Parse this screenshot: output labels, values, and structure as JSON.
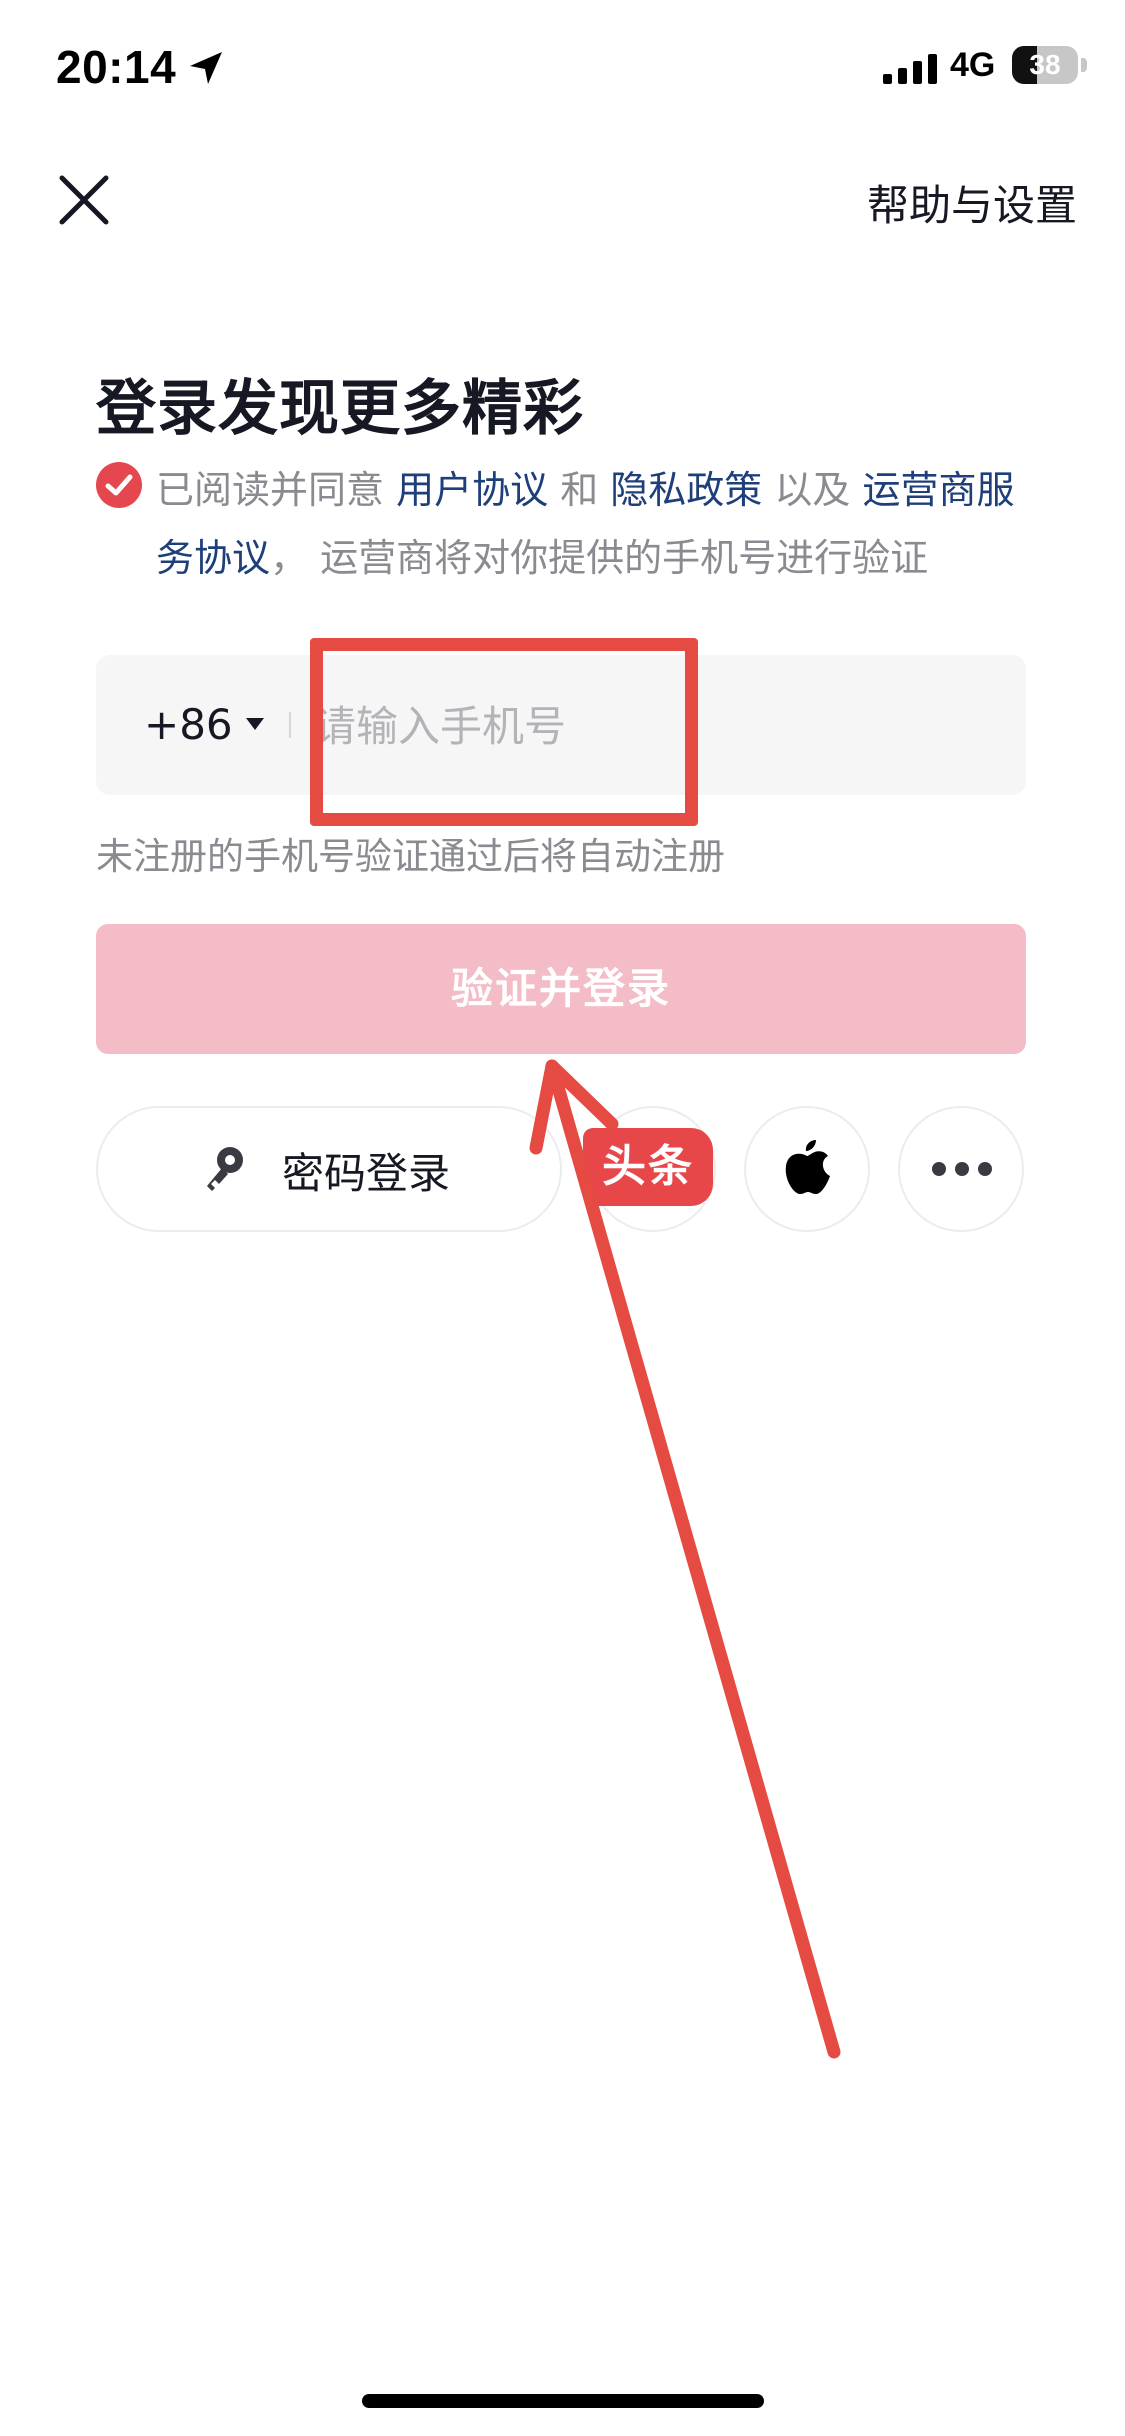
{
  "status_bar": {
    "time": "20:14",
    "network": "4G",
    "battery": "38",
    "battery_level": 0.38,
    "icons": [
      "location-arrow-icon",
      "signal-icon",
      "battery-icon"
    ]
  },
  "nav": {
    "close_icon": "close-icon",
    "help_label": "帮助与设置"
  },
  "title": "登录发现更多精彩",
  "agreement": {
    "checked": true,
    "check_color": "#e5474f",
    "prefix": "已阅读并同意 ",
    "user_agreement": "用户协议",
    "and": " 和 ",
    "privacy_policy": "隐私政策",
    "as_well_as": " 以及 ",
    "carrier_agreement": "运营商服务协议",
    "suffix": "， 运营商将对你提供的手机号进行验证"
  },
  "phone": {
    "country_code": "+86",
    "placeholder": "请输入手机号",
    "value": ""
  },
  "hint": "未注册的手机号验证通过后将自动注册",
  "login_button": {
    "label": "验证并登录",
    "color": "#f4bcc6"
  },
  "alt_login": {
    "password_label": "密码登录",
    "toutiao_label": "头条",
    "icons": [
      "key-icon",
      "apple-icon",
      "more-icon"
    ]
  },
  "annotation": {
    "color": "#e54a43"
  }
}
